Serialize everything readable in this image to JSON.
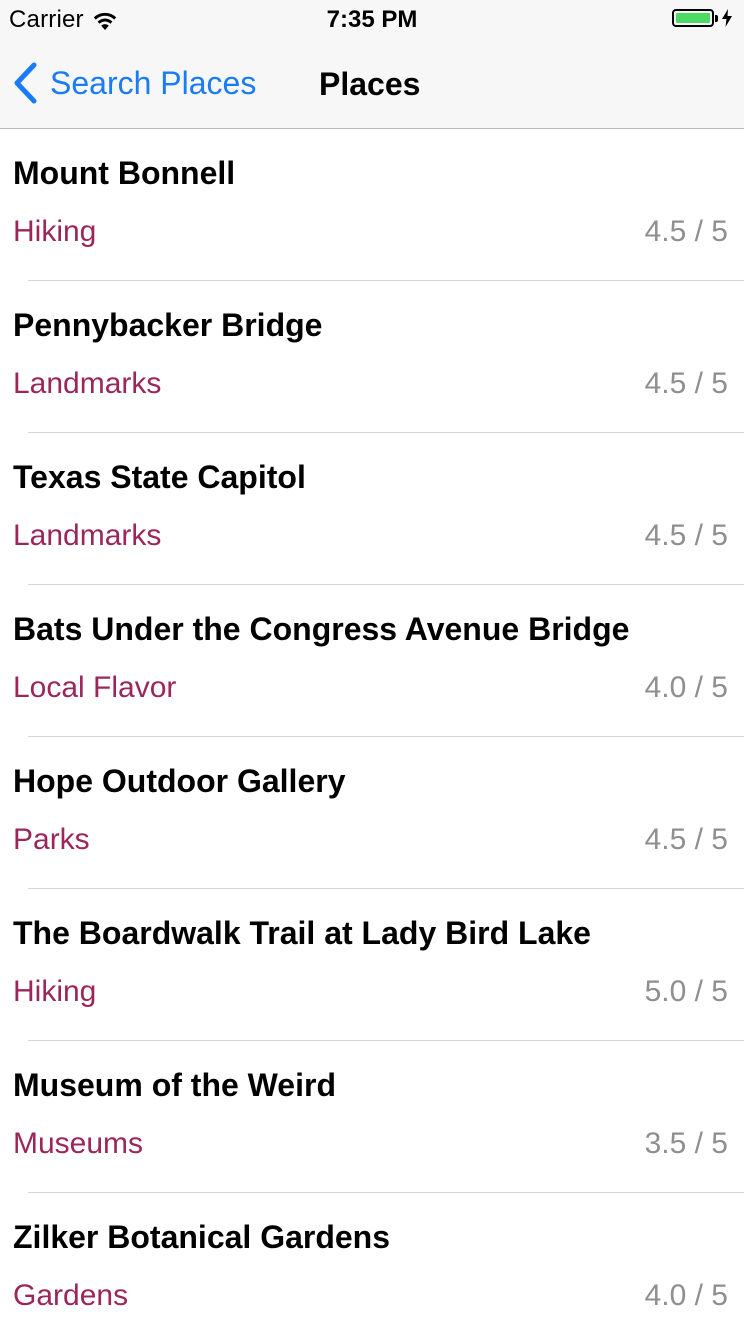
{
  "status_bar": {
    "carrier": "Carrier",
    "time": "7:35 PM",
    "battery_level": 1.0,
    "battery_color": "#4cd964",
    "wifi_icon": "wifi-icon",
    "charging_icon": "charging-bolt-icon"
  },
  "navbar": {
    "back_label": "Search Places",
    "back_icon": "chevron-left-icon",
    "title": "Places",
    "accent_color": "#1a7cf5"
  },
  "places": [
    {
      "name": "Mount Bonnell",
      "category": "Hiking",
      "rating": "4.5 / 5"
    },
    {
      "name": "Pennybacker Bridge",
      "category": "Landmarks",
      "rating": "4.5 / 5"
    },
    {
      "name": "Texas State Capitol",
      "category": "Landmarks",
      "rating": "4.5 / 5"
    },
    {
      "name": "Bats Under the Congress Avenue Bridge",
      "category": "Local Flavor",
      "rating": "4.0 / 5"
    },
    {
      "name": "Hope Outdoor Gallery",
      "category": "Parks",
      "rating": "4.5 / 5"
    },
    {
      "name": "The Boardwalk Trail at Lady Bird Lake",
      "category": "Hiking",
      "rating": "5.0 / 5"
    },
    {
      "name": "Museum of the Weird",
      "category": "Museums",
      "rating": "3.5 / 5"
    },
    {
      "name": "Zilker Botanical Gardens",
      "category": "Gardens",
      "rating": "4.0 / 5"
    }
  ],
  "colors": {
    "category": "#9b2659",
    "rating": "#8e8e93"
  }
}
